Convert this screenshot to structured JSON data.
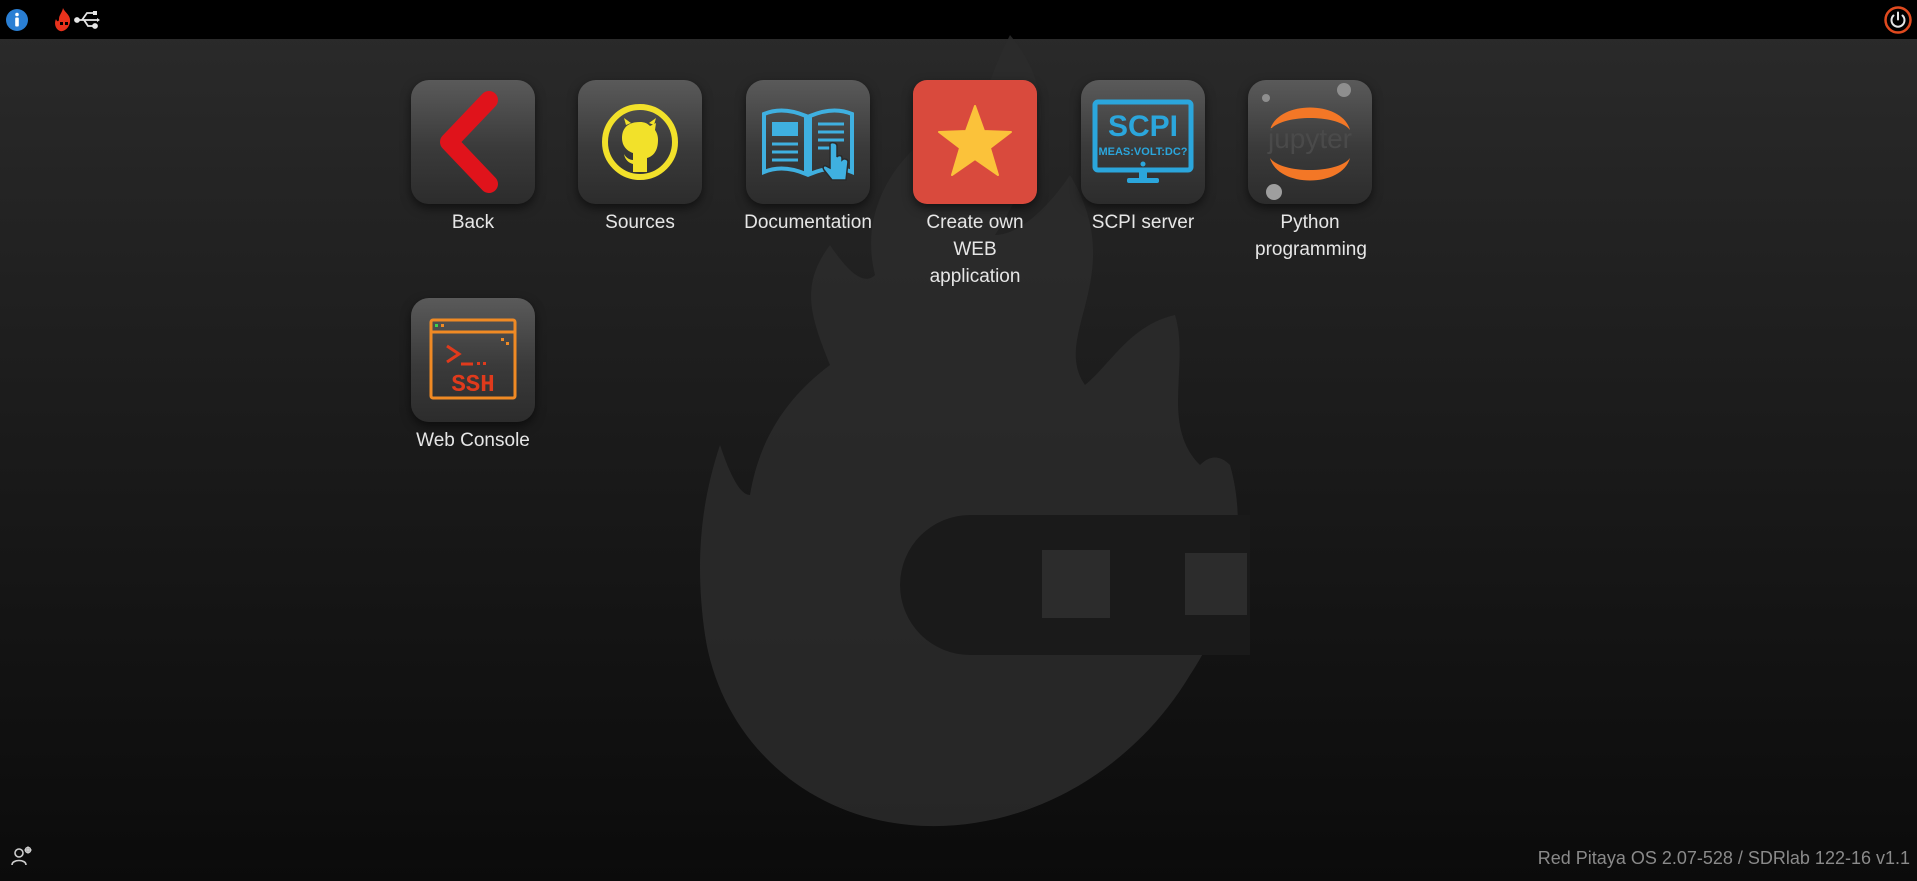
{
  "apps": [
    {
      "label": "Back",
      "icon": "back-arrow-icon"
    },
    {
      "label": "Sources",
      "icon": "github-icon"
    },
    {
      "label": "Documentation",
      "icon": "documentation-book-icon"
    },
    {
      "label": "Create own WEB application",
      "icon": "star-icon"
    },
    {
      "label": "SCPI server",
      "icon": "scpi-monitor-icon",
      "icon_text_top": "SCPI",
      "icon_text_bottom": "MEAS:VOLT:DC?"
    },
    {
      "label": "Python programming",
      "icon": "jupyter-icon",
      "icon_text": "jupyter"
    },
    {
      "label": "Web Console",
      "icon": "ssh-terminal-icon",
      "icon_text": "SSH"
    }
  ],
  "footer": {
    "version": "Red Pitaya OS 2.07-528 / SDRlab 122-16 v1.1"
  },
  "colors": {
    "info": "#2a7fd4",
    "power": "#e04a1f",
    "back": "#e0131b",
    "github": "#f2e12a",
    "docs": "#3fb0e0",
    "star_bg": "#d94a3d",
    "star": "#fbc23a",
    "scpi": "#2ba6dc",
    "jupyter": "#f37726",
    "ssh": "#f08a24"
  }
}
